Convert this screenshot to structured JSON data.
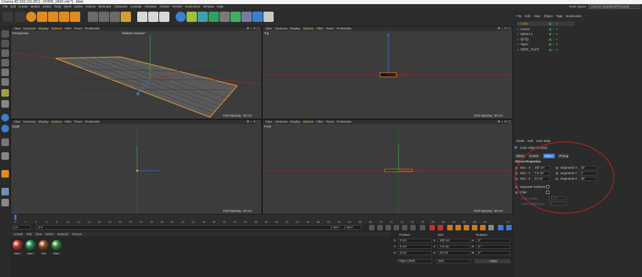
{
  "title": "Cinema 4D S22.116 (RC) - [아파트_0420.c4d *] - Main",
  "menu": [
    "File",
    "Edit",
    "Create",
    "Modes",
    "Select",
    "Tools",
    "Mesh",
    "Spline",
    "Volume",
    "MoGraph",
    "Character",
    "Animate",
    "Simulate",
    "Tracker",
    "Render",
    "Extensions",
    "Window",
    "Help"
  ],
  "layout": {
    "label": "Node Space",
    "value": "Current (Standard/Physical)"
  },
  "viewport_menu": {
    "view": "View",
    "cameras": "Cameras",
    "display": "Display",
    "options": "Options",
    "filter": "Filter",
    "panel": "Panel",
    "prorender": "ProRender"
  },
  "viewports": [
    {
      "label": "Perspective",
      "camera": "Default Camera:*",
      "grid": "Grid Spacing : 50 cm"
    },
    {
      "label": "Top",
      "grid": "Grid Spacing : 50 cm"
    },
    {
      "label": "Right",
      "grid": "Grid Spacing : 50 cm"
    },
    {
      "label": "Front",
      "grid": "Grid Spacing : 50 cm"
    }
  ],
  "timeline": {
    "ticks": [
      "0",
      "2",
      "4",
      "6",
      "8",
      "10",
      "12",
      "14",
      "16",
      "18",
      "20",
      "22",
      "24",
      "26",
      "28",
      "30",
      "32",
      "34",
      "36",
      "38",
      "40",
      "42",
      "44",
      "46",
      "48",
      "50",
      "52",
      "54",
      "56",
      "58",
      "60",
      "62",
      "64",
      "66",
      "68",
      "70",
      "72",
      "74",
      "76",
      "78",
      "80",
      "82",
      "84",
      "86",
      "88",
      "90"
    ],
    "end_label": "0 F",
    "start": "0 F",
    "current": "0 F",
    "end": "90 F",
    "end2": "90 F"
  },
  "material_menu": [
    "Create",
    "Edit",
    "View",
    "Select",
    "Material",
    "Texture"
  ],
  "materials": [
    {
      "name": "Mat.3",
      "color": "#c0342a"
    },
    {
      "name": "Mat.1",
      "color": "#1e8a4a"
    },
    {
      "name": "Mat",
      "color": "#8a4a1a"
    },
    {
      "name": "Mat.2",
      "color": "#2e8a3a"
    }
  ],
  "coords": {
    "headers": {
      "position": "Position",
      "size": "Size",
      "rotation": "Rotation"
    },
    "rows": [
      {
        "axis": "X",
        "pos": "0 cm",
        "saxis": "X",
        "size": "100 cm",
        "raxis": "H",
        "rot": "0 °"
      },
      {
        "axis": "Y",
        "pos": "0 cm",
        "saxis": "Y",
        "size": "7.5 cm",
        "raxis": "P",
        "rot": "0 °"
      },
      {
        "axis": "Z",
        "pos": "0 cm",
        "saxis": "Z",
        "size": "24 cm",
        "raxis": "B",
        "rot": "0 °"
      }
    ],
    "mode": "Object (Rel)",
    "size_mode": "Size",
    "apply": "Apply"
  },
  "object_menu": [
    "File",
    "Edit",
    "View",
    "Object",
    "Tags",
    "Bookmarks"
  ],
  "objects": [
    {
      "name": "Cube",
      "selected": true
    },
    {
      "name": "Corner",
      "selected": false
    },
    {
      "name": "Sphere.1",
      "selected": false
    },
    {
      "name": "뒷기둥",
      "selected": false
    },
    {
      "name": "Taper",
      "selected": false
    },
    {
      "name": "아파트_주요부",
      "selected": false
    }
  ],
  "attr_menu": [
    "Mode",
    "Edit",
    "User Data"
  ],
  "attributes": {
    "object_title": "Cube Object [Cube]",
    "tabs": [
      "Basic",
      "Coord.",
      "Object",
      "Phong"
    ],
    "active_tab": "Object",
    "section": "Object Properties",
    "size": [
      {
        "label": "Size . X",
        "value": "100 cm"
      },
      {
        "label": "Size . Y",
        "value": "7.5 cm"
      },
      {
        "label": "Size . Z",
        "value": "24 cm"
      }
    ],
    "segments": [
      {
        "label": "Segments X",
        "value": "20"
      },
      {
        "label": "Segments Y",
        "value": "2"
      },
      {
        "label": "Segments Z",
        "value": "20"
      }
    ],
    "separate": "Separate Surfaces",
    "fillet": "Fillet",
    "fillet_radius": {
      "label": "Fillet Radius",
      "value": "5 cm"
    },
    "fillet_subdiv": {
      "label": "Fillet Subdivision",
      "value": "5"
    }
  },
  "colors": {
    "accent": "#3a7ad5",
    "highlight": "#cc2222",
    "selection": "#f0a030"
  }
}
